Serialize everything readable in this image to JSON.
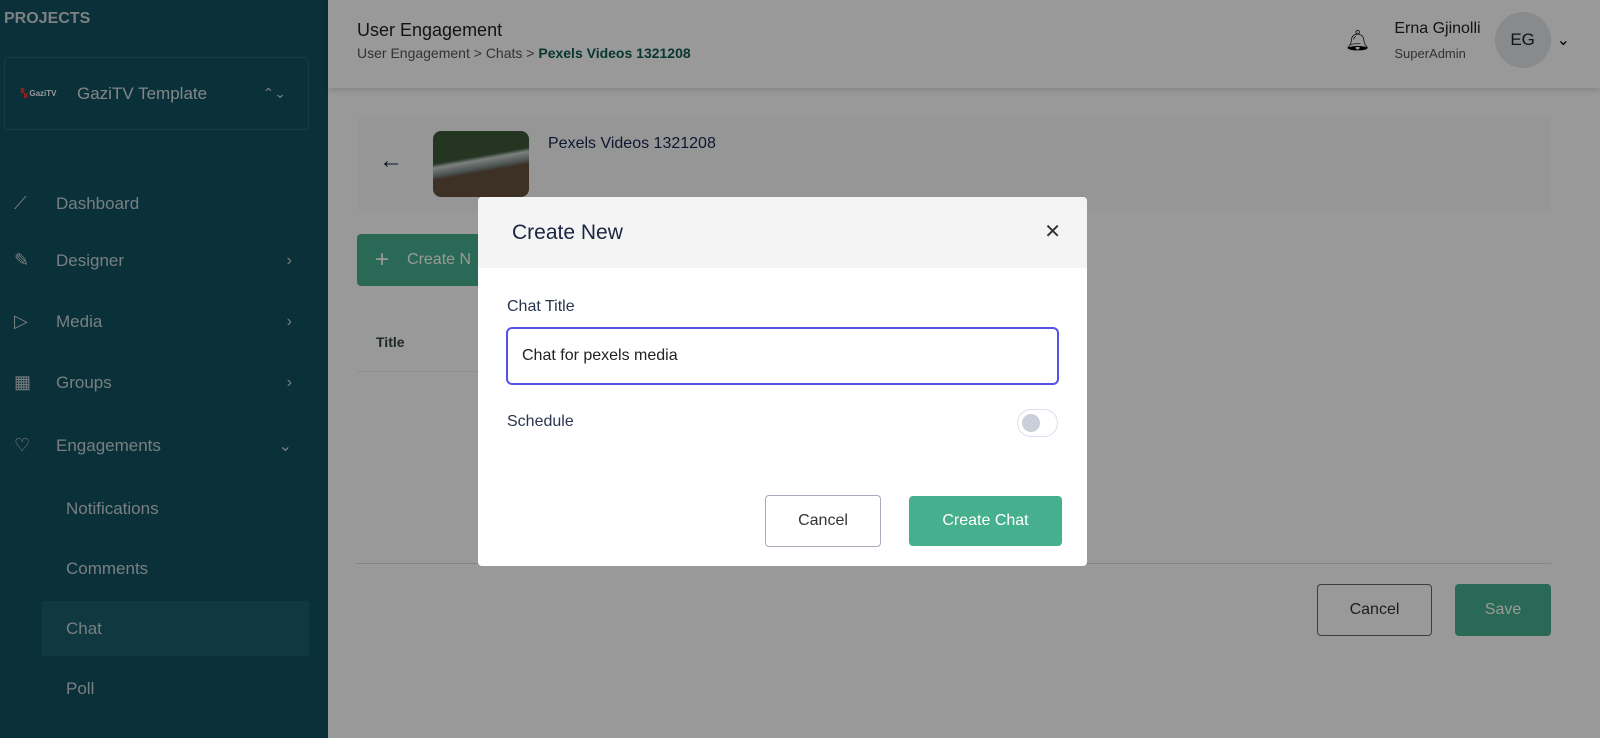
{
  "sidebar": {
    "projects_label": "PROJECTS",
    "project": {
      "logo": "GaziTV",
      "name": "GaziTV Template"
    },
    "items": [
      {
        "label": "Dashboard",
        "icon": "chart-line-icon"
      },
      {
        "label": "Designer",
        "icon": "tools-icon"
      },
      {
        "label": "Media",
        "icon": "play-icon"
      },
      {
        "label": "Groups",
        "icon": "grid-icon"
      },
      {
        "label": "Engagements",
        "icon": "heart-icon"
      }
    ],
    "subitems": [
      {
        "label": "Notifications"
      },
      {
        "label": "Comments"
      },
      {
        "label": "Chat",
        "active": true
      },
      {
        "label": "Poll"
      }
    ]
  },
  "header": {
    "title": "User Engagement",
    "breadcrumb": [
      "User Engagement",
      "Chats",
      "Pexels Videos 1321208"
    ],
    "user": {
      "name": "Erna Gjinolli",
      "role": "SuperAdmin",
      "initials": "EG"
    }
  },
  "main": {
    "media_title": "Pexels Videos 1321208",
    "create_label": "Create N",
    "table_header": "Title",
    "cancel_label": "Cancel",
    "save_label": "Save"
  },
  "modal": {
    "title": "Create New",
    "chat_title_label": "Chat Title",
    "chat_title_value": "Chat for pexels media",
    "schedule_label": "Schedule",
    "schedule_on": false,
    "cancel_label": "Cancel",
    "create_label": "Create Chat"
  },
  "colors": {
    "sidebar": "#125060",
    "accent": "#46b08e",
    "focus": "#5a4fe6"
  }
}
